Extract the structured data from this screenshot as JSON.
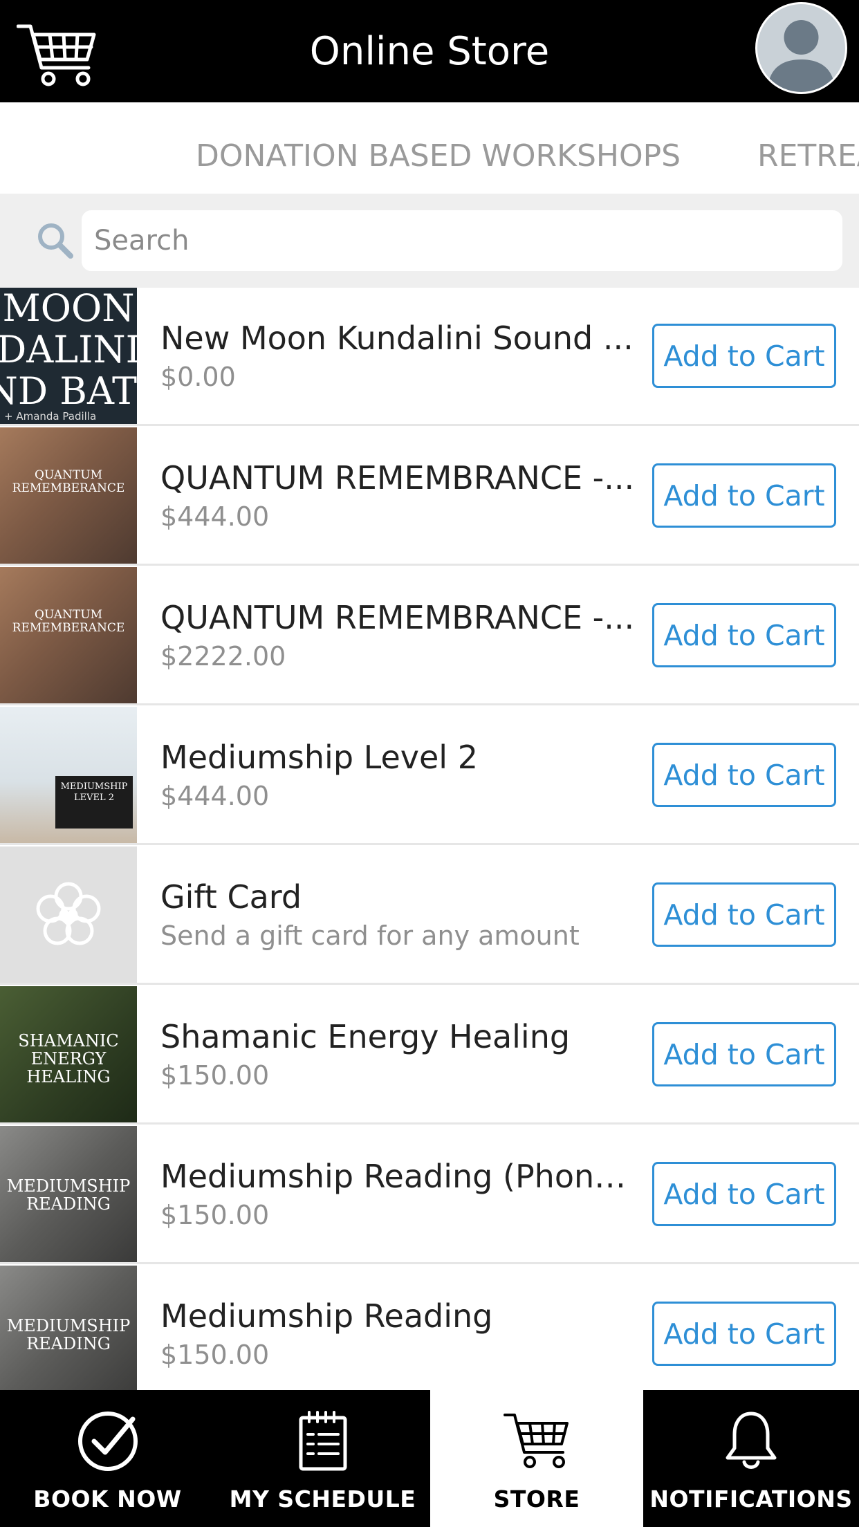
{
  "header": {
    "title": "Online Store",
    "cart_icon": "shopping-cart-icon",
    "avatar_icon": "user-avatar-icon"
  },
  "category_tabs": [
    {
      "label": "DONATION BASED WORKSHOPS"
    },
    {
      "label": "RETREA"
    }
  ],
  "search": {
    "placeholder": "Search",
    "value": "",
    "icon": "search-icon"
  },
  "products": [
    {
      "name": "New Moon Kundalini Sound ...",
      "price": "$0.00",
      "button": "Add to Cart",
      "thumb_lines": [
        "MOON",
        "DALINI",
        "ND BATI"
      ],
      "thumb_caption": "+ Amanda Padilla"
    },
    {
      "name": "QUANTUM REMEMBRANCE -...",
      "price": "$444.00",
      "button": "Add to Cart",
      "thumb_lines": [
        "QUANTUM",
        "REMEMBERANCE"
      ]
    },
    {
      "name": "QUANTUM REMEMBRANCE -...",
      "price": "$2222.00",
      "button": "Add to Cart",
      "thumb_lines": [
        "QUANTUM",
        "REMEMBERANCE"
      ]
    },
    {
      "name": "Mediumship Level 2",
      "price": "$444.00",
      "button": "Add to Cart",
      "thumb_lines": [
        "MEDIUMSHIP",
        "LEVEL 2"
      ]
    },
    {
      "name": "Gift Card",
      "price": "Send a gift card for any amount",
      "button": "Add to Cart",
      "thumb_icon": "heart-flower-icon"
    },
    {
      "name": "Shamanic Energy Healing",
      "price": "$150.00",
      "button": "Add to Cart",
      "thumb_lines": [
        "SHAMANIC",
        "ENERGY",
        "HEALING"
      ]
    },
    {
      "name": "Mediumship Reading (Phone...",
      "price": "$150.00",
      "button": "Add to Cart",
      "thumb_lines": [
        "MEDIUMSHIP",
        "READING"
      ]
    },
    {
      "name": "Mediumship Reading",
      "price": "$150.00",
      "button": "Add to Cart",
      "thumb_lines": [
        "MEDIUMSHIP",
        "READING"
      ]
    }
  ],
  "tabbar": [
    {
      "label": "BOOK NOW",
      "icon": "checkmark-circle-icon",
      "active": false
    },
    {
      "label": "MY SCHEDULE",
      "icon": "calendar-icon",
      "active": false
    },
    {
      "label": "STORE",
      "icon": "shopping-cart-icon",
      "active": true
    },
    {
      "label": "NOTIFICATIONS",
      "icon": "bell-icon",
      "active": false
    }
  ],
  "colors": {
    "header_bg": "#000000",
    "accent": "#2e8fd6",
    "muted_text": "#8f8f8f",
    "search_bg": "#efefef"
  }
}
